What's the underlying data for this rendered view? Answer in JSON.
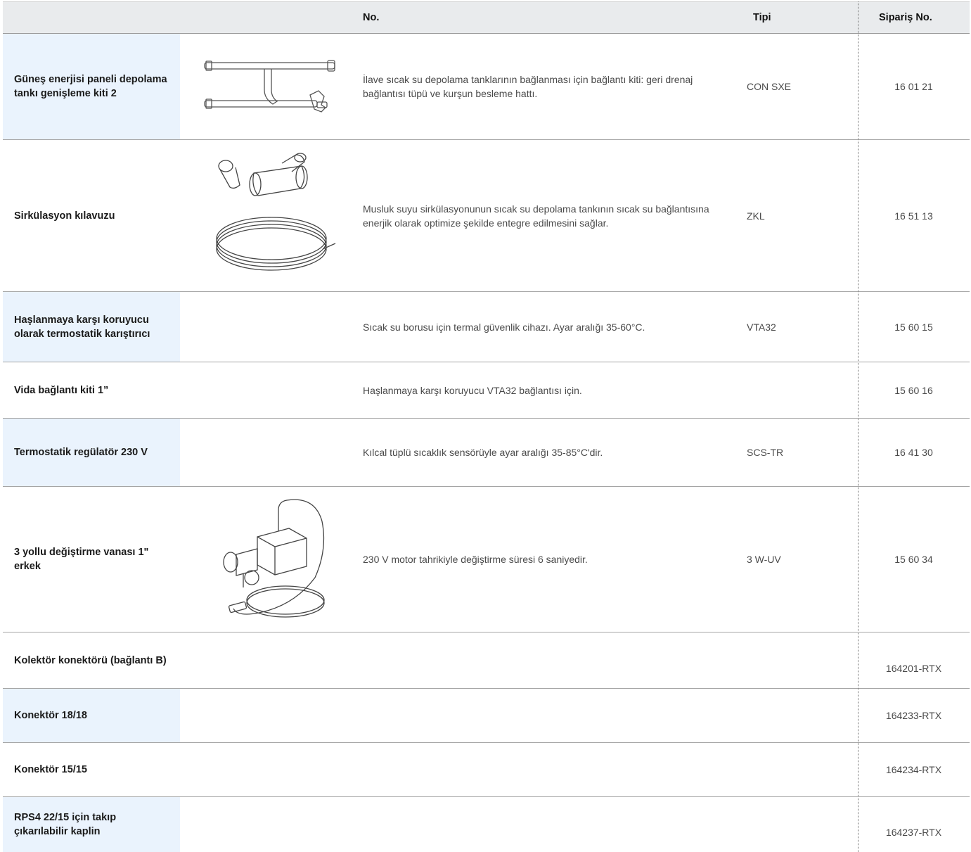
{
  "header": {
    "no": "No.",
    "tipi": "Tipi",
    "siparis": "Sipariş No."
  },
  "rows": [
    {
      "name": "Güneş enerjisi paneli depolama tankı genişleme kiti 2",
      "image": "pipe-extension-kit",
      "description": "İlave sıcak su depolama tanklarının bağlanması için bağlantı kiti: geri drenaj bağlantısı tüpü ve kurşun besleme hattı.",
      "type": "CON SXE",
      "order_no": "16 01 21"
    },
    {
      "name": "Sirkülasyon kılavuzu",
      "image": "circulation-fitting-coil",
      "description": "Musluk suyu sirkülasyonunun sıcak su depolama tankının sıcak su bağlantısına enerjik olarak optimize şekilde entegre edilmesini sağlar.",
      "type": "ZKL",
      "order_no": "16 51 13"
    },
    {
      "name": "Haşlanmaya karşı koruyucu olarak termostatik karıştırıcı",
      "image": "",
      "description": "Sıcak su borusu için termal güvenlik cihazı. Ayar aralığı 35-60°C.",
      "type": "VTA32",
      "order_no": "15 60 15"
    },
    {
      "name": "Vida bağlantı kiti 1”",
      "image": "",
      "description": "Haşlanmaya karşı koruyucu VTA32 bağlantısı için.",
      "type": "",
      "order_no": "15 60 16"
    },
    {
      "name": "Termostatik regülatör 230 V",
      "image": "",
      "description": "Kılcal tüplü sıcaklık sensörüyle ayar aralığı 35-85°C'dir.",
      "type": "SCS-TR",
      "order_no": "16 41 30"
    },
    {
      "name": "3 yollu değiştirme vanası 1\" erkek",
      "image": "three-way-valve",
      "description": "230 V motor tahrikiyle değiştirme süresi 6 saniyedir.",
      "type": "3 W-UV",
      "order_no": "15 60 34"
    },
    {
      "name": "Kolektör konektörü (bağlantı B)",
      "image": "",
      "description": "",
      "type": "",
      "order_no": "164201-RTX"
    },
    {
      "name": "Konektör 18/18",
      "image": "",
      "description": "",
      "type": "",
      "order_no": "164233-RTX"
    },
    {
      "name": "Konektör 15/15",
      "image": "",
      "description": "",
      "type": "",
      "order_no": "164234-RTX"
    },
    {
      "name": "RPS4 22/15 için takıp çıkarılabilir kaplin",
      "image": "",
      "description": "",
      "type": "",
      "order_no": "164237-RTX"
    }
  ],
  "colors": {
    "header_bg": "#e9ebed",
    "highlight_bg": "#eaf3fd",
    "border": "#a5a5a5"
  }
}
